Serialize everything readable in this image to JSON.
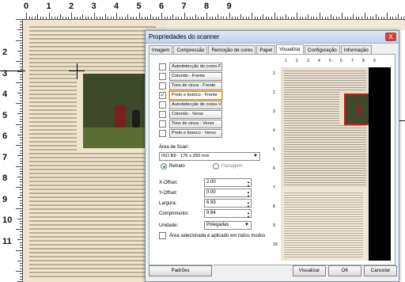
{
  "background": {
    "top_ruler_numbers": [
      "0",
      "1",
      "2",
      "3",
      "4",
      "5",
      "6",
      "7",
      "8",
      "9"
    ],
    "left_ruler_numbers": [
      "2",
      "3",
      "4",
      "5",
      "6",
      "7",
      "8",
      "9",
      "10",
      "11"
    ]
  },
  "dialog": {
    "title": "Propriedades do scanner",
    "close_label": "X",
    "tabs": [
      {
        "label": "Imagem"
      },
      {
        "label": "Compressão"
      },
      {
        "label": "Remoção de cores"
      },
      {
        "label": "Papel"
      },
      {
        "label": "Visualizar"
      },
      {
        "label": "Configuração"
      },
      {
        "label": "Informação"
      }
    ],
    "active_tab": "Visualizar",
    "image_list": [
      {
        "label": "Autodetecção de cores-F",
        "checked": false
      },
      {
        "label": "Colorido - Frente",
        "checked": false
      },
      {
        "label": "Tons de cinza - Frente",
        "checked": false
      },
      {
        "label": "Preto e branco - Frente",
        "checked": true,
        "selected": true
      },
      {
        "label": "Autodetecção de cores-V",
        "checked": false
      },
      {
        "label": "Colorido - Verso",
        "checked": false
      },
      {
        "label": "Tons de cinza - Verso",
        "checked": false
      },
      {
        "label": "Preto e branco - Verso",
        "checked": false
      }
    ],
    "scan_area": {
      "label": "Área de Scan:",
      "value": "ISO B5 - 176 x 250 mm",
      "options": [
        {
          "label": "Retrato",
          "selected": true
        },
        {
          "label": "Paisagem",
          "selected": false
        }
      ]
    },
    "fields": [
      {
        "label": "X-Offset:",
        "value": "2.00"
      },
      {
        "label": "Y-Offset:",
        "value": "0.00"
      },
      {
        "label": "Largura:",
        "value": "6.93"
      },
      {
        "label": "Comprimento:",
        "value": "9.84"
      }
    ],
    "unit": {
      "label": "Unidade:",
      "value": "Polegadas"
    },
    "apply_all": {
      "label": "Área selecionada é aplicado em todos modos",
      "checked": false
    },
    "preview": {
      "ruler_top": [
        "1",
        "2",
        "3",
        "4",
        "5",
        "6",
        "7",
        "8",
        "9"
      ],
      "ruler_left": [
        "1",
        "2",
        "3",
        "4",
        "5",
        "6",
        "7",
        "8",
        "9",
        "10"
      ]
    },
    "buttons": {
      "defaults": "Padrões",
      "preview": "Visualizar",
      "ok": "OK",
      "cancel": "Cancelar"
    }
  },
  "colors": {
    "selection_frame": "#d11111",
    "selected_item_border": "#e68a1a"
  }
}
